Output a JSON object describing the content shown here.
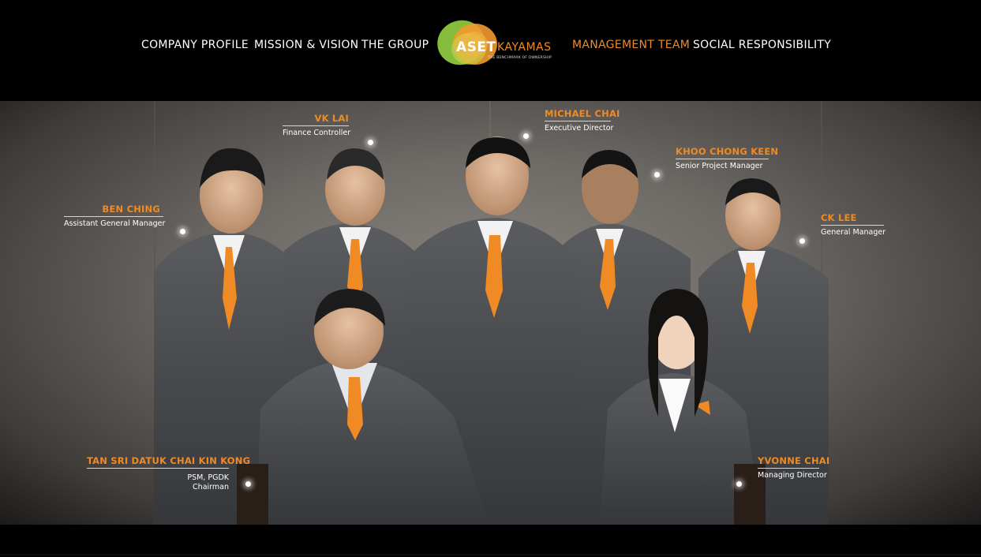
{
  "nav": {
    "items": [
      {
        "label": "COMPANY PROFILE"
      },
      {
        "label": "MISSION & VISION"
      },
      {
        "label": "THE GROUP"
      },
      {
        "label": "MANAGEMENT TEAM",
        "active": true
      },
      {
        "label": "SOCIAL RESPONSIBILITY"
      }
    ]
  },
  "logo": {
    "brand_primary": "ASET",
    "brand_secondary": "KAYAMAS",
    "tagline": "THE BENCHMARK OF OWNERSHIP"
  },
  "colors": {
    "accent": "#f08a24",
    "background": "#000000"
  },
  "team": [
    {
      "name": "VK LAI",
      "title": "Finance Controller"
    },
    {
      "name": "MICHAEL CHAI",
      "title": "Executive Director"
    },
    {
      "name": "KHOO CHONG KEEN",
      "title": "Senior Project Manager"
    },
    {
      "name": "BEN CHING",
      "title": "Assistant General Manager"
    },
    {
      "name": "CK LEE",
      "title": "General Manager"
    },
    {
      "name": "TAN SRI DATUK CHAI KIN KONG",
      "title": "PSM, PGDK",
      "title2": "Chairman"
    },
    {
      "name": "YVONNE CHAI",
      "title": "Managing Director"
    }
  ]
}
